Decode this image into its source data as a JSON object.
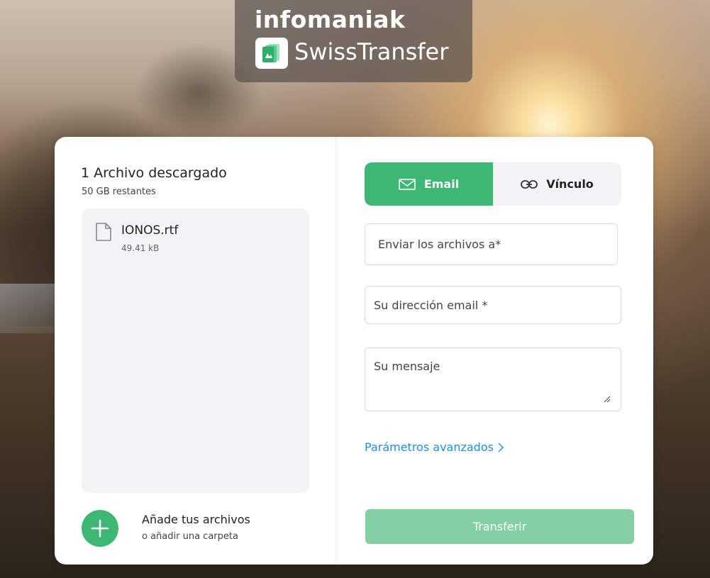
{
  "brand": {
    "org": "infomaniak",
    "product": "SwissTransfer"
  },
  "files": {
    "title": "1 Archivo descargado",
    "remaining": "50 GB restantes",
    "items": [
      {
        "name": "IONOS.rtf",
        "size": "49.41 kB",
        "icon": "file-icon"
      }
    ]
  },
  "add": {
    "title": "Añade tus archivos",
    "subtitle": "o añadir una carpeta",
    "icon": "plus-icon"
  },
  "tabs": [
    {
      "label": "Email",
      "icon": "mail-icon",
      "active": true
    },
    {
      "label": "Vínculo",
      "icon": "link-icon",
      "active": false
    }
  ],
  "form": {
    "to_placeholder": "Enviar los archivos a*",
    "from_placeholder": "Su dirección email *",
    "message_placeholder": "Su mensaje",
    "advanced_label": "Parámetros avanzados",
    "submit_label": "Transferir"
  },
  "colors": {
    "accent": "#3cb774",
    "accent_disabled": "#82d0a4",
    "link": "#1f8fe0"
  }
}
